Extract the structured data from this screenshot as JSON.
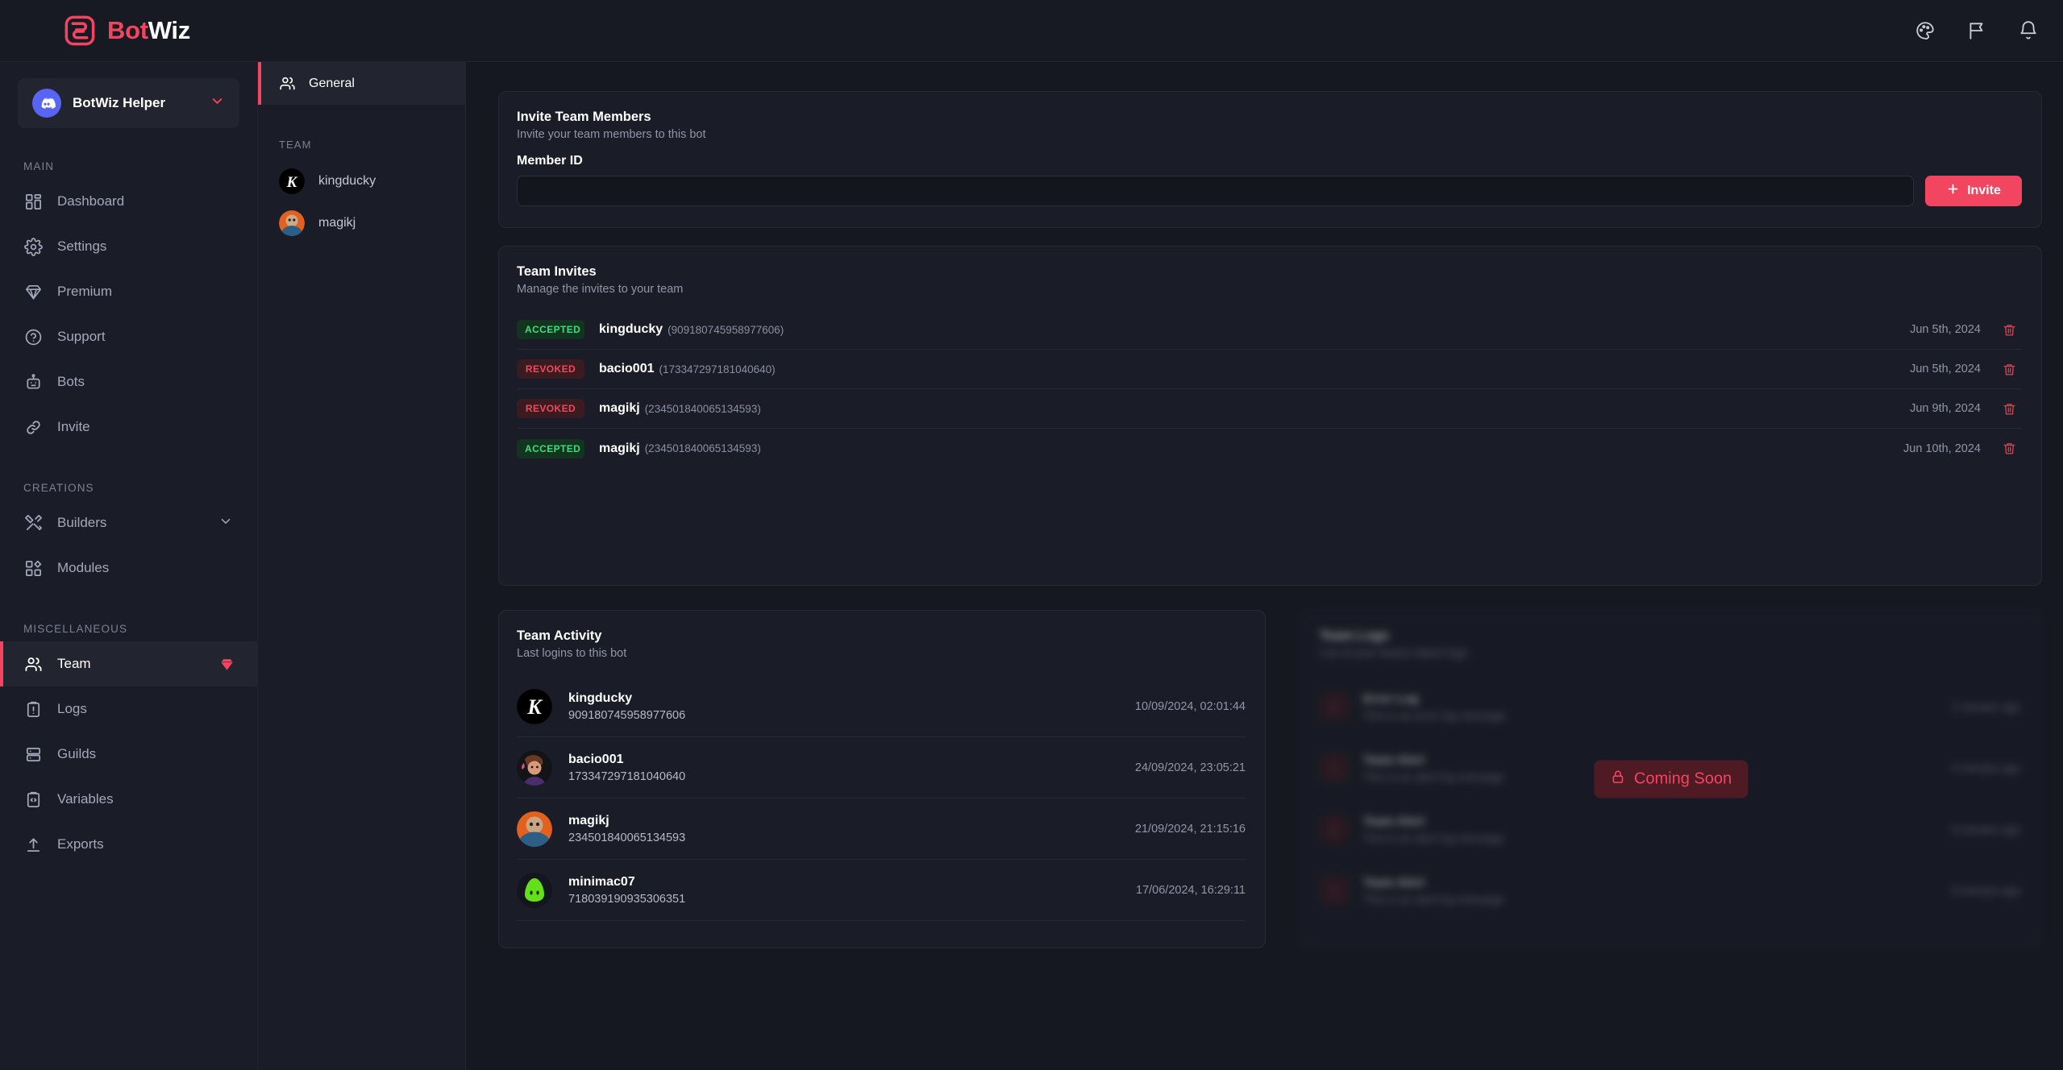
{
  "brand": {
    "name_part1": "Bot",
    "name_part2": "Wiz",
    "logo_icon": "botwiz-logo-icon"
  },
  "topbar": {
    "icons": [
      {
        "name": "palette-icon",
        "label": "Theme"
      },
      {
        "name": "flag-icon",
        "label": "Feedback"
      },
      {
        "name": "bell-icon",
        "label": "Notifications"
      }
    ]
  },
  "sidebar": {
    "bot_selector": {
      "name": "BotWiz Helper",
      "avatar_icon": "discord-icon",
      "caret_icon": "chevron-down-icon"
    },
    "groups": [
      {
        "title": "MAIN",
        "items": [
          {
            "label": "Dashboard",
            "icon": "dashboard-icon"
          },
          {
            "label": "Settings",
            "icon": "gear-icon"
          },
          {
            "label": "Premium",
            "icon": "diamond-icon"
          },
          {
            "label": "Support",
            "icon": "question-circle-icon"
          },
          {
            "label": "Bots",
            "icon": "robot-icon"
          },
          {
            "label": "Invite",
            "icon": "link-icon"
          }
        ]
      },
      {
        "title": "CREATIONS",
        "items": [
          {
            "label": "Builders",
            "icon": "tools-icon",
            "chevron": "chevron-down-icon"
          },
          {
            "label": "Modules",
            "icon": "modules-icon"
          }
        ]
      },
      {
        "title": "MISCELLANEOUS",
        "items": [
          {
            "label": "Team",
            "icon": "users-icon",
            "active": true,
            "badge_icon": "diamond-badge-icon"
          },
          {
            "label": "Logs",
            "icon": "clipboard-alert-icon"
          },
          {
            "label": "Guilds",
            "icon": "server-icon"
          },
          {
            "label": "Variables",
            "icon": "code-clipboard-icon"
          },
          {
            "label": "Exports",
            "icon": "upload-icon"
          }
        ]
      }
    ]
  },
  "subpanel": {
    "tabs": [
      {
        "label": "General",
        "icon": "users-icon",
        "active": true
      }
    ],
    "team_group_title": "TEAM",
    "members": [
      {
        "name": "kingducky",
        "avatar": "letter-k-avatar"
      },
      {
        "name": "magikj",
        "avatar": "monkey-avatar"
      }
    ]
  },
  "invite_card": {
    "title": "Invite Team Members",
    "subtitle": "Invite your team members to this bot",
    "field_label": "Member ID",
    "input_value": "",
    "input_placeholder": "",
    "button_label": "Invite",
    "button_icon": "plus-icon",
    "accent_color": "#f2455f"
  },
  "invites_card": {
    "title": "Team Invites",
    "subtitle": "Manage the invites to your team",
    "delete_icon": "trash-icon",
    "rows": [
      {
        "status": "ACCEPTED",
        "status_type": "accepted",
        "name": "kingducky",
        "id": "(909180745958977606)",
        "date": "Jun 5th, 2024"
      },
      {
        "status": "REVOKED",
        "status_type": "revoked",
        "name": "bacio001",
        "id": "(173347297181040640)",
        "date": "Jun 5th, 2024"
      },
      {
        "status": "REVOKED",
        "status_type": "revoked",
        "name": "magikj",
        "id": "(234501840065134593)",
        "date": "Jun 9th, 2024"
      },
      {
        "status": "ACCEPTED",
        "status_type": "accepted",
        "name": "magikj",
        "id": "(234501840065134593)",
        "date": "Jun 10th, 2024"
      }
    ]
  },
  "activity_card": {
    "title": "Team Activity",
    "subtitle": "Last logins to this bot",
    "rows": [
      {
        "name": "kingducky",
        "id": "909180745958977606",
        "time": "10/09/2024, 02:01:44",
        "avatar": "letter-k-avatar"
      },
      {
        "name": "bacio001",
        "id": "173347297181040640",
        "time": "24/09/2024, 23:05:21",
        "avatar": "person-avatar"
      },
      {
        "name": "magikj",
        "id": "234501840065134593",
        "time": "21/09/2024, 21:15:16",
        "avatar": "monkey-avatar"
      },
      {
        "name": "minimac07",
        "id": "718039190935306351",
        "time": "17/06/2024, 16:29:11",
        "avatar": "slime-avatar"
      }
    ]
  },
  "logs_card": {
    "title": "Team Logs",
    "subtitle": "List of your teams latest logs",
    "overlay_label": "Coming Soon",
    "overlay_icon": "lock-icon",
    "rows": [
      {
        "title": "Error Log",
        "message": "This is an error log message",
        "time": "2 minutes ago"
      },
      {
        "title": "Team Alert",
        "message": "This is an alert log message",
        "time": "4 minutes ago"
      },
      {
        "title": "Team Alert",
        "message": "This is an alert log message",
        "time": "6 minutes ago"
      },
      {
        "title": "Team Alert",
        "message": "This is an alert log message",
        "time": "8 minutes ago"
      }
    ]
  }
}
